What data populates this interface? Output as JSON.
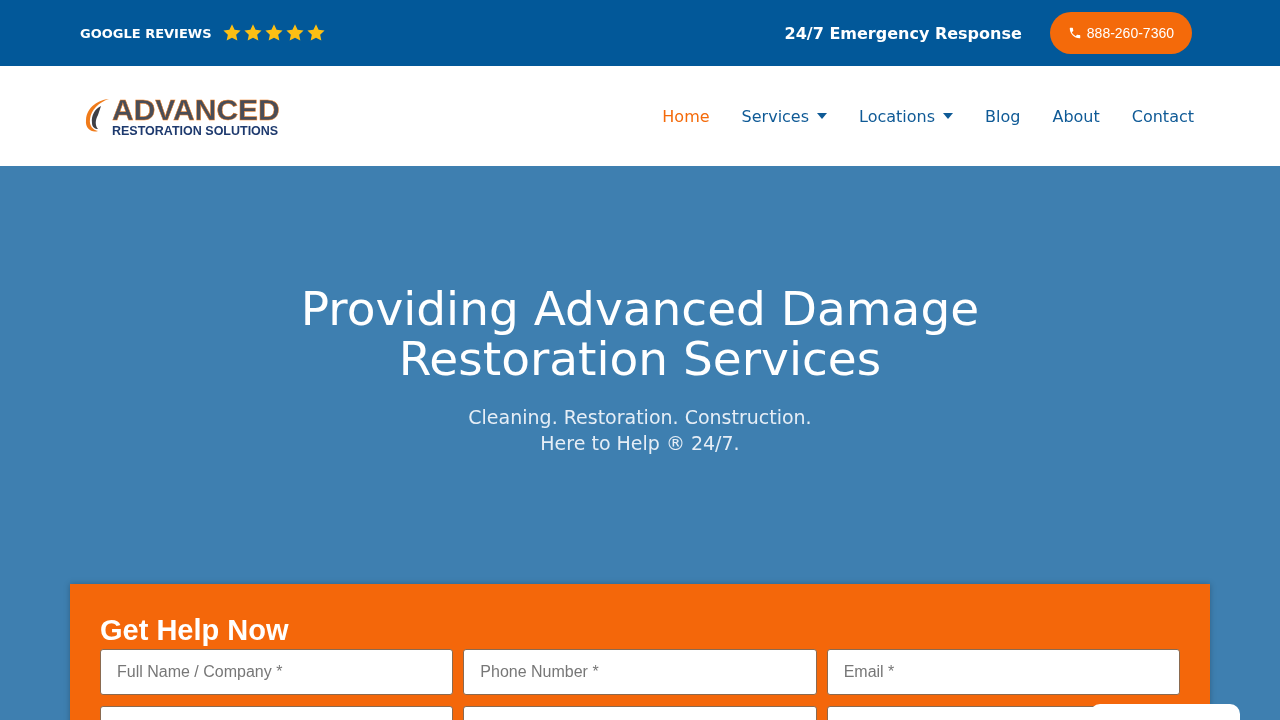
{
  "top_bar": {
    "reviews_label": "GOOGLE REVIEWS",
    "stars": 5,
    "tagline": "24/7 Emergency Response",
    "phone": "888-260-7360"
  },
  "logo": {
    "name": "ADVANCED",
    "subtitle": "RESTORATION SOLUTIONS"
  },
  "nav": [
    {
      "label": "Home",
      "selected": true,
      "has_menu": false
    },
    {
      "label": "Services",
      "selected": false,
      "has_menu": true
    },
    {
      "label": "Locations",
      "selected": false,
      "has_menu": true
    },
    {
      "label": "Blog",
      "selected": false,
      "has_menu": false
    },
    {
      "label": "About",
      "selected": false,
      "has_menu": false
    },
    {
      "label": "Contact",
      "selected": false,
      "has_menu": false
    }
  ],
  "hero": {
    "title": "Providing Advanced Damage Restoration Services",
    "subtitle_lines": [
      "Cleaning. Restoration. Construction.",
      "Here to Help ® 24/7."
    ]
  },
  "form": {
    "title": "Get Help Now",
    "fields": [
      {
        "placeholder": "Full Name / Company *"
      },
      {
        "placeholder": "Phone Number *"
      },
      {
        "placeholder": "Email *"
      }
    ]
  }
}
